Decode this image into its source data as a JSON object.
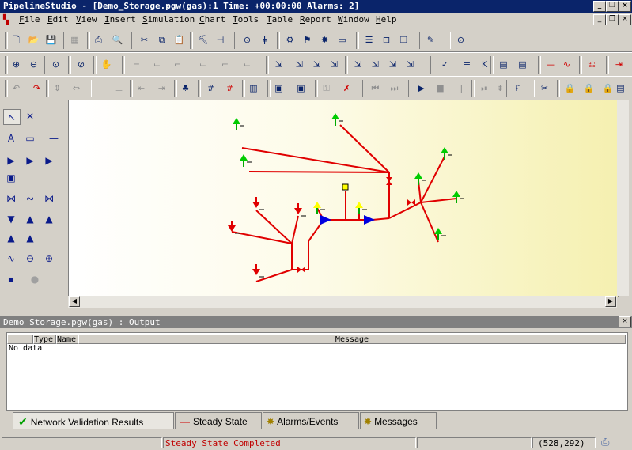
{
  "app": {
    "title": "PipelineStudio - [Demo_Storage.pgw(gas):1 Time: +00:00:00 Alarms: 2]",
    "window_buttons": [
      "_",
      "❐",
      "×"
    ],
    "child_buttons": [
      "_",
      "❐",
      "×"
    ]
  },
  "menu": [
    "File",
    "Edit",
    "View",
    "Insert",
    "Simulation",
    "Chart",
    "Tools",
    "Table",
    "Report",
    "Window",
    "Help"
  ],
  "toolbars": {
    "row1": [
      {
        "name": "new",
        "glyph": "🗋"
      },
      {
        "name": "open",
        "glyph": "📂"
      },
      {
        "name": "save",
        "glyph": "💾"
      },
      {
        "name": "print-preview-grey",
        "glyph": "▦"
      },
      {
        "name": "print",
        "glyph": "⎙"
      },
      {
        "name": "preview",
        "glyph": "🔍"
      },
      {
        "name": "cut",
        "glyph": "✂"
      },
      {
        "name": "copy",
        "glyph": "⧉"
      },
      {
        "name": "paste",
        "glyph": "📋"
      },
      {
        "name": "brush",
        "glyph": "⛏"
      },
      {
        "name": "pin",
        "glyph": "⊣"
      },
      {
        "name": "binoculars",
        "glyph": "⊙"
      },
      {
        "name": "rsi-bar",
        "glyph": "ǂ"
      },
      {
        "name": "network",
        "glyph": "⚙"
      },
      {
        "name": "properties",
        "glyph": "⚑"
      },
      {
        "name": "alarm",
        "glyph": "✸"
      },
      {
        "name": "comment",
        "glyph": "▭"
      },
      {
        "name": "layout-h",
        "glyph": "☰"
      },
      {
        "name": "layout-v",
        "glyph": "⊟"
      },
      {
        "name": "cascade",
        "glyph": "❐"
      },
      {
        "name": "notes",
        "glyph": "✎"
      },
      {
        "name": "find",
        "glyph": "⊙"
      }
    ],
    "row2": [
      {
        "name": "zoom-in",
        "glyph": "⊕"
      },
      {
        "name": "zoom-out",
        "glyph": "⊖"
      },
      {
        "name": "zoom-fit",
        "glyph": "⊙"
      },
      {
        "name": "zoom-reset",
        "glyph": "⊘"
      },
      {
        "name": "pan",
        "glyph": "✋"
      },
      {
        "name": "node-a",
        "glyph": "⌐"
      },
      {
        "name": "node-b",
        "glyph": "⌙"
      },
      {
        "name": "node-c",
        "glyph": "⌐"
      },
      {
        "name": "node-d",
        "glyph": "⌙"
      },
      {
        "name": "node-e",
        "glyph": "⌐"
      },
      {
        "name": "node-f",
        "glyph": "⌙"
      },
      {
        "name": "select-1",
        "glyph": "⇲"
      },
      {
        "name": "select-2",
        "glyph": "⇲"
      },
      {
        "name": "select-3",
        "glyph": "⇲"
      },
      {
        "name": "select-4",
        "glyph": "⇲"
      },
      {
        "name": "select-5",
        "glyph": "⇲"
      },
      {
        "name": "select-6",
        "glyph": "⇲"
      },
      {
        "name": "select-7",
        "glyph": "⇲"
      },
      {
        "name": "select-8",
        "glyph": "⇲"
      },
      {
        "name": "check",
        "glyph": "✓"
      },
      {
        "name": "xml",
        "glyph": "≡"
      },
      {
        "name": "kw",
        "glyph": "K"
      },
      {
        "name": "doc",
        "glyph": "▤"
      },
      {
        "name": "doc2",
        "glyph": "▤"
      },
      {
        "name": "red-line",
        "glyph": "—"
      },
      {
        "name": "red-wave",
        "glyph": "∿"
      },
      {
        "name": "red-link",
        "glyph": "⎌"
      },
      {
        "name": "red-arrow",
        "glyph": "⇥"
      }
    ],
    "row3": [
      {
        "name": "undo",
        "glyph": "↶"
      },
      {
        "name": "redo",
        "glyph": "↷"
      },
      {
        "name": "align-1",
        "glyph": "⇕"
      },
      {
        "name": "align-2",
        "glyph": "⇔"
      },
      {
        "name": "align-3",
        "glyph": "⊤"
      },
      {
        "name": "align-4",
        "glyph": "⊥"
      },
      {
        "name": "align-5",
        "glyph": "⇤"
      },
      {
        "name": "align-6",
        "glyph": "⇥"
      },
      {
        "name": "tree",
        "glyph": "♣"
      },
      {
        "name": "grid",
        "glyph": "#"
      },
      {
        "name": "grid-red",
        "glyph": "#"
      },
      {
        "name": "chart",
        "glyph": "▥"
      },
      {
        "name": "report-1",
        "glyph": "▣"
      },
      {
        "name": "report-2",
        "glyph": "▣"
      },
      {
        "name": "lock-a",
        "glyph": "⚿"
      },
      {
        "name": "unlock",
        "glyph": "✗"
      },
      {
        "name": "rewind",
        "glyph": "⏮"
      },
      {
        "name": "fast-forward",
        "glyph": "⏭"
      },
      {
        "name": "play",
        "glyph": "▶"
      },
      {
        "name": "stop",
        "glyph": "■"
      },
      {
        "name": "pause",
        "glyph": "‖"
      },
      {
        "name": "step",
        "glyph": "⏯"
      },
      {
        "name": "step-down",
        "glyph": "⇟"
      },
      {
        "name": "mark",
        "glyph": "⚐"
      },
      {
        "name": "tools",
        "glyph": "✂"
      },
      {
        "name": "lock-1",
        "glyph": "🔒"
      },
      {
        "name": "lock-2",
        "glyph": "🔒"
      },
      {
        "name": "lock-3",
        "glyph": "🔒"
      },
      {
        "name": "page",
        "glyph": "▤"
      }
    ]
  },
  "palette": [
    {
      "name": "pointer",
      "glyph": "↖"
    },
    {
      "name": "cross",
      "glyph": "✕"
    },
    {
      "name": "text",
      "glyph": "A"
    },
    {
      "name": "box",
      "glyph": "▭"
    },
    {
      "name": "line-short",
      "glyph": "–"
    },
    {
      "name": "line",
      "glyph": "—"
    },
    {
      "name": "compressor-g",
      "glyph": "▶"
    },
    {
      "name": "compressor-c",
      "glyph": "▶"
    },
    {
      "name": "compressor-r",
      "glyph": "▶"
    },
    {
      "name": "block-b",
      "glyph": "▣"
    },
    {
      "name": "valve",
      "glyph": "⋈"
    },
    {
      "name": "check-valve",
      "glyph": "∾"
    },
    {
      "name": "regulator",
      "glyph": "⋈"
    },
    {
      "name": "supply",
      "glyph": "▼"
    },
    {
      "name": "delivery",
      "glyph": "▲"
    },
    {
      "name": "delivery-f",
      "glyph": "▲"
    },
    {
      "name": "supply-e",
      "glyph": "▲"
    },
    {
      "name": "delivery-l",
      "glyph": "▲"
    },
    {
      "name": "resistor",
      "glyph": "∿"
    },
    {
      "name": "heater",
      "glyph": "⊖"
    },
    {
      "name": "cooler",
      "glyph": "⊕"
    },
    {
      "name": "node",
      "glyph": "▪"
    },
    {
      "name": "dot",
      "glyph": "●"
    }
  ],
  "output": {
    "header": "Demo_Storage.pgw(gas) : Output",
    "columns": [
      "Type",
      "Name",
      "Message"
    ],
    "rows": [
      "No data"
    ]
  },
  "tabs": [
    "Network Validation Results",
    "Steady State",
    "Alarms/Events",
    "Messages"
  ],
  "status": {
    "message": "Steady State Completed",
    "coords": "(528,292)"
  },
  "colors": {
    "pipe": "#e00000",
    "supply": "#e00000",
    "delivery": "#00cc00",
    "compressor": "#0000e0",
    "storage": "#ffff00",
    "titlebar": "#0a246a",
    "status_message": "#c00000"
  }
}
